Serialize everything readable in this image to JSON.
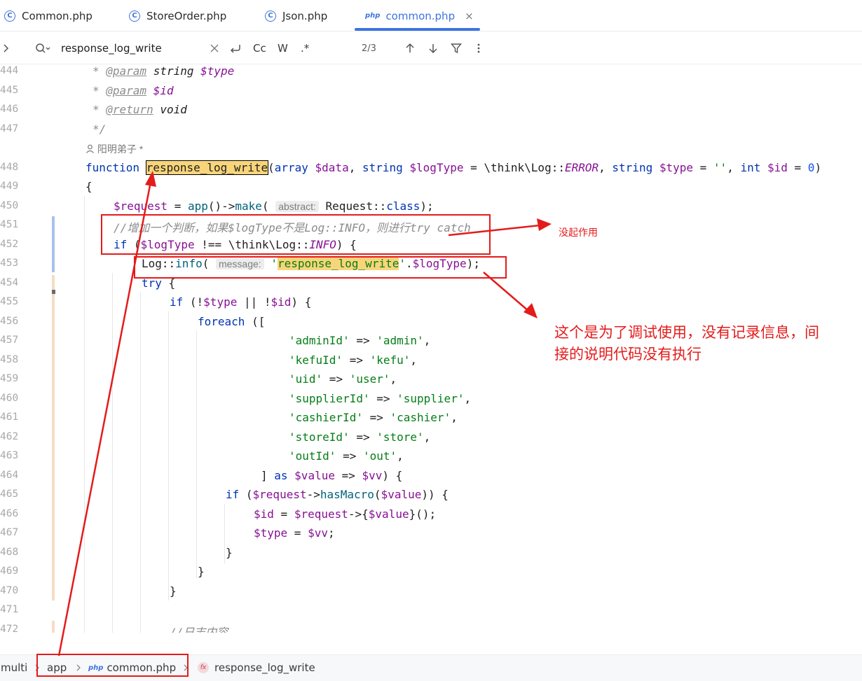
{
  "tabs": [
    {
      "label": "Common.php",
      "icon": "class-c-icon",
      "active": false
    },
    {
      "label": "StoreOrder.php",
      "icon": "class-c-icon",
      "active": false
    },
    {
      "label": "Json.php",
      "icon": "class-c-icon",
      "active": false
    },
    {
      "label": "common.php",
      "icon": "php-file-icon",
      "icon_text": "php",
      "active": true,
      "close": "×"
    }
  ],
  "find": {
    "query": "response_log_write",
    "match_case_label": "Cc",
    "words_label": "W",
    "regex_label": ".*",
    "counter": "2/3"
  },
  "editor": {
    "lines": [
      "444",
      "445",
      "446",
      "447",
      "448",
      "449",
      "450",
      "451",
      "452",
      "453",
      "454",
      "455",
      "456",
      "457",
      "458",
      "459",
      "460",
      "461",
      "462",
      "463",
      "464",
      "465",
      "466",
      "467",
      "468",
      "469",
      "470",
      "471",
      "472"
    ],
    "author": "阳明弟子 *",
    "hint_abstract": "abstract:",
    "hint_message": "message:",
    "highlight_name": "response_log_write"
  },
  "breadcrumb": {
    "root": "multi",
    "folder": "app",
    "file": "common.php",
    "file_icon_text": "php",
    "function": "response_log_write",
    "function_icon_text": "fx"
  },
  "annotations": {
    "no_effect": "没起作用",
    "debug_note_line1": "这个是为了调试使用，没有记录信息，间",
    "debug_note_line2": "接的说明代码没有执行"
  },
  "colors": {
    "accent": "#3d74e0",
    "annotation_red": "#e41b1b",
    "search_highlight": "#f8d57a"
  }
}
